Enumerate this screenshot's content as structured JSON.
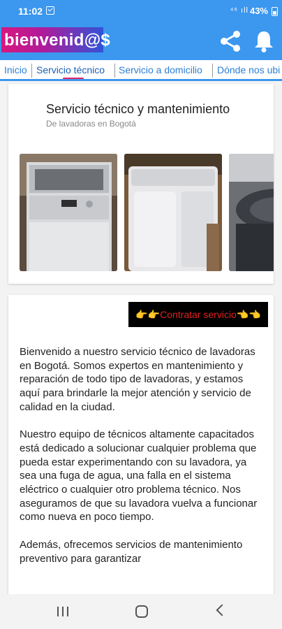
{
  "status_bar": {
    "time": "11:02",
    "signal_text": "⁴⁶ ıll",
    "battery": "43%"
  },
  "app_bar": {
    "logo_text": "bienvenid@$"
  },
  "tabs": [
    {
      "label": "Inicio"
    },
    {
      "label": "Servicio técnico"
    },
    {
      "label": "Servicio a domicilio"
    },
    {
      "label": "Dónde nos ubi"
    }
  ],
  "service_card": {
    "title": "Servicio técnico y mantenimiento",
    "subtitle": "De lavadoras en Bogotá",
    "images": [
      "washing-machine-photo",
      "washing-machine-photo",
      "washing-machine-photo"
    ]
  },
  "info_card": {
    "cta_label": "👉👉Contratar servicio👈👈",
    "paragraphs": [
      "Bienvenido a nuestro servicio técnico de lavadoras en Bogotá. Somos expertos en mantenimiento y reparación de todo tipo de lavadoras, y estamos aquí para brindarle la mejor atención y servicio de calidad en la ciudad.",
      "Nuestro equipo de técnicos altamente capacitados está dedicado a solucionar cualquier problema que pueda estar experimentando con su lavadora, ya sea una fuga de agua, una falla en el sistema eléctrico o cualquier otro problema técnico. Nos aseguramos de que su lavadora vuelva a funcionar como nueva en poco tiempo.",
      "Además, ofrecemos servicios de mantenimiento preventivo para garantizar"
    ]
  },
  "colors": {
    "primary": "#3c97ee",
    "tab_indicator": "#e5236b",
    "cta_text": "#e02020"
  }
}
